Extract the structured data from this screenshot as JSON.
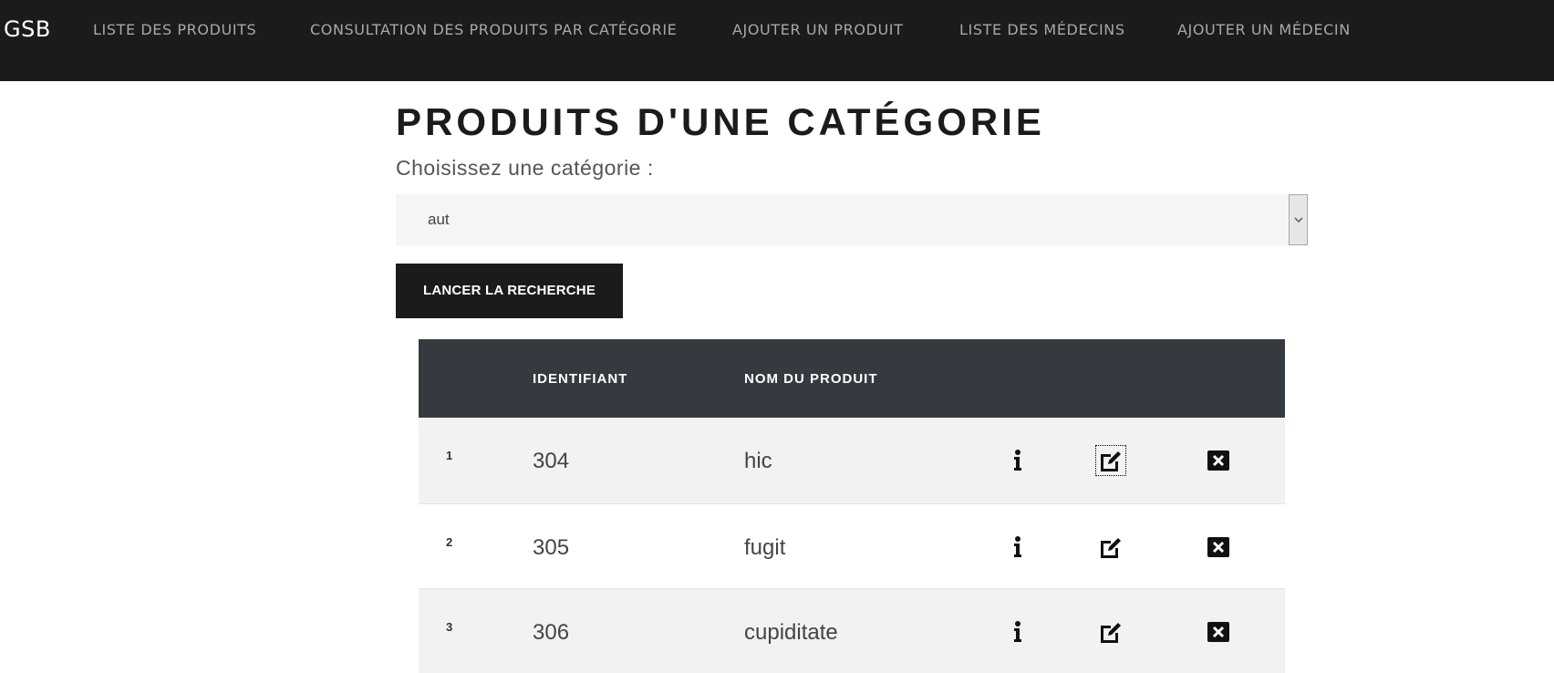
{
  "brand": "GSB",
  "nav": {
    "items": [
      {
        "label": "LISTE DES PRODUITS"
      },
      {
        "label": "CONSULTATION DES PRODUITS PAR CATÉGORIE"
      },
      {
        "label": "AJOUTER UN PRODUIT"
      },
      {
        "label": "LISTE DES MÉDECINS"
      },
      {
        "label": "AJOUTER UN MÉDECIN"
      }
    ]
  },
  "page": {
    "title": "PRODUITS D'UNE CATÉGORIE",
    "select_label": "Choisissez une catégorie :",
    "select_value": "aut",
    "search_button": "LANCER LA RECHERCHE"
  },
  "table": {
    "headers": {
      "index": "",
      "id": "IDENTIFIANT",
      "name": "NOM DU PRODUIT"
    },
    "rows": [
      {
        "index": "1",
        "id": "304",
        "name": "hic"
      },
      {
        "index": "2",
        "id": "305",
        "name": "fugit"
      },
      {
        "index": "3",
        "id": "306",
        "name": "cupiditate"
      }
    ],
    "actions": [
      "info-icon",
      "edit-icon",
      "delete-icon"
    ]
  },
  "colors": {
    "navbar": "#1b1b1b",
    "table_header": "#343a40",
    "row_alt": "#f2f2f2",
    "button": "#1b1b1b"
  }
}
